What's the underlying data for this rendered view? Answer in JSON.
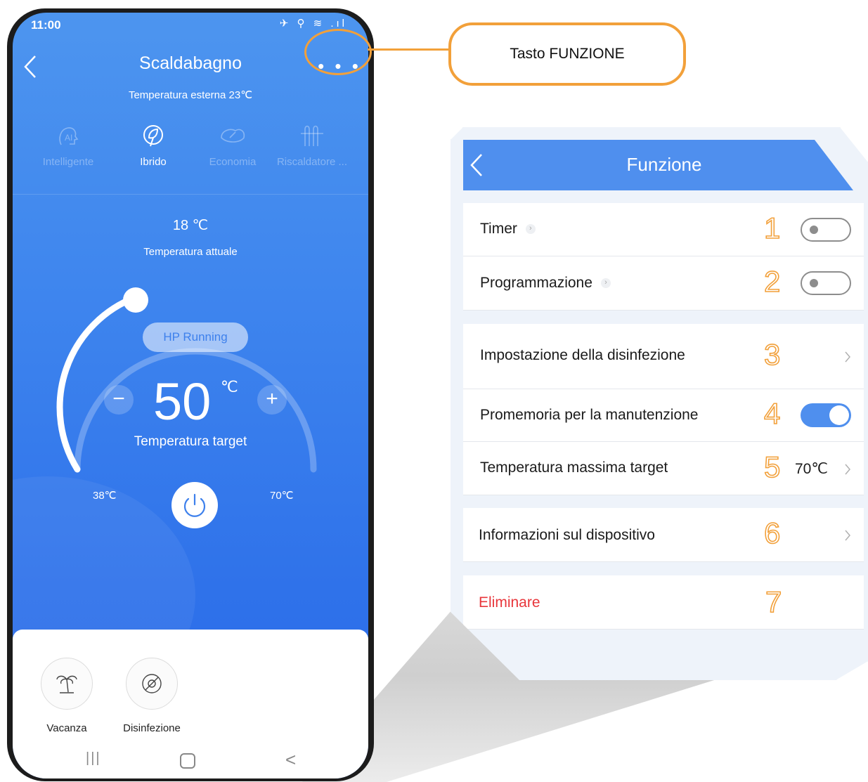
{
  "phone": {
    "status_time": "11:00",
    "status_icons": "✈ ⚲ ≋ .ıl",
    "title": "Scaldabagno",
    "more_label": "• • •",
    "outside_temperature": "Temperatura esterna 23℃",
    "modes": [
      {
        "label": "Intelligente",
        "icon": "ai-head-icon",
        "active": false
      },
      {
        "label": "Ibrido",
        "icon": "hybrid-leaf-icon",
        "active": true
      },
      {
        "label": "Economia",
        "icon": "eco-leaf-icon",
        "active": false
      },
      {
        "label": "Riscaldatore ...",
        "icon": "heater-icon",
        "active": false
      }
    ],
    "current_temp": "18 ℃",
    "current_temp_label": "Temperatura attuale",
    "status_pill": "HP Running",
    "minus": "−",
    "plus": "+",
    "target_temp": "50",
    "target_unit": "℃",
    "target_label": "Temperatura target",
    "min_temp": "38℃",
    "max_temp": "70℃",
    "bottom_actions": [
      {
        "label": "Vacanza",
        "icon": "palm-tree-icon"
      },
      {
        "label": "Disinfezione",
        "icon": "disinfection-icon"
      }
    ],
    "nav": {
      "recent": "|||",
      "back": "<"
    }
  },
  "callout": {
    "label": "Tasto FUNZIONE",
    "color": "#f2a03a"
  },
  "panel": {
    "title": "Funzione",
    "rows": [
      {
        "label": "Timer",
        "number": "1",
        "control": "toggle",
        "on": false
      },
      {
        "label": "Programmazione",
        "number": "2",
        "control": "toggle",
        "on": false
      },
      {
        "label": "Impostazione della disinfezione",
        "number": "3",
        "control": "chevron"
      },
      {
        "label": "Promemoria per la manutenzione",
        "number": "4",
        "control": "toggle",
        "on": true
      },
      {
        "label": "Temperatura massima target",
        "number": "5",
        "control": "value",
        "value": "70℃"
      },
      {
        "label": "Informazioni sul dispositivo",
        "number": "6",
        "control": "chevron"
      },
      {
        "label": "Eliminare",
        "number": "7",
        "control": "none"
      }
    ],
    "accent": "#4f8fee",
    "danger": "#e8363b"
  }
}
